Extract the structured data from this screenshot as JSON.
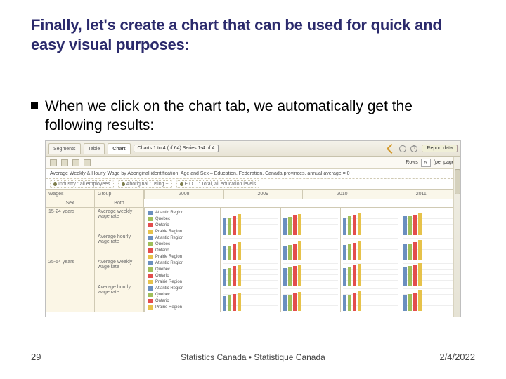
{
  "slide": {
    "title": "Finally, let's create a chart that can be used for quick and easy visual purposes:",
    "bullet": "When we click on the chart tab, we automatically get the following results:",
    "page_number": "29",
    "footer_center": "Statistics Canada • Statistique Canada",
    "footer_date": "2/4/2022"
  },
  "app": {
    "tabs": [
      "Segments",
      "Table",
      "Chart"
    ],
    "active_tab": "Chart",
    "breadcrumb": "Charts 1 to 4 (of 64)   Series 1-4 of 4",
    "report_button": "Report data",
    "rows_label": "Rows",
    "rows_value": "5",
    "rows_per_page": "(per page)",
    "headline": "Average Weekly & Hourly Wage by Aboriginal identification, Age and Sex – Education, Federation, Canada provinces, annual average = 0",
    "criteria": {
      "industry": {
        "label": "Industry",
        "value": "all employees"
      },
      "aboriginal": {
        "label": "Aboriginal",
        "value": "using +"
      },
      "eol": {
        "label": "E.O.L",
        "value": "Total, all education levels"
      }
    },
    "left_header": "Wages",
    "row_labels": {
      "age1": "15-24 years",
      "age2": "25-54 years",
      "sex_hdr": "Sex",
      "both": "Both",
      "wage_type_weekly": "Average weekly wage rate",
      "wage_type_hourly": "Average hourly wage rate",
      "group_label": "Group"
    },
    "legend": [
      "Atlantic Region",
      "Quebec",
      "Ontario",
      "Prairie Region"
    ],
    "colors": {
      "Atlantic Region": "#6a8fbf",
      "Quebec": "#9fbf5a",
      "Ontario": "#e34d4d",
      "Prairie Region": "#e6c24a"
    },
    "years": [
      "2008",
      "2009",
      "2010",
      "2011"
    ]
  },
  "chart_data": [
    {
      "type": "bar",
      "title": "Average weekly wage rate — 15-24 years, Both sexes",
      "xlabel": "",
      "ylabel": "",
      "ylim": [
        0,
        600
      ],
      "categories": [
        "2008",
        "2009",
        "2010",
        "2011"
      ],
      "series": [
        {
          "name": "Atlantic Region",
          "values": [
            390,
            400,
            410,
            430
          ]
        },
        {
          "name": "Quebec",
          "values": [
            400,
            420,
            430,
            440
          ]
        },
        {
          "name": "Ontario",
          "values": [
            440,
            450,
            460,
            470
          ]
        },
        {
          "name": "Prairie Region",
          "values": [
            480,
            490,
            500,
            520
          ]
        }
      ]
    },
    {
      "type": "bar",
      "title": "Average hourly wage rate — 15-24 years, Both sexes",
      "xlabel": "",
      "ylabel": "",
      "ylim": [
        0,
        20
      ],
      "categories": [
        "2008",
        "2009",
        "2010",
        "2011"
      ],
      "series": [
        {
          "name": "Atlantic Region",
          "values": [
            11,
            11.5,
            12,
            12.5
          ]
        },
        {
          "name": "Quebec",
          "values": [
            11.5,
            12,
            12.5,
            13
          ]
        },
        {
          "name": "Ontario",
          "values": [
            12.5,
            13,
            13.5,
            14
          ]
        },
        {
          "name": "Prairie Region",
          "values": [
            14,
            14.5,
            15,
            15.5
          ]
        }
      ]
    },
    {
      "type": "bar",
      "title": "Average weekly wage rate — 25-54 years, Both sexes",
      "xlabel": "",
      "ylabel": "",
      "ylim": [
        0,
        1200
      ],
      "categories": [
        "2008",
        "2009",
        "2010",
        "2011"
      ],
      "series": [
        {
          "name": "Atlantic Region",
          "values": [
            780,
            800,
            820,
            850
          ]
        },
        {
          "name": "Quebec",
          "values": [
            820,
            840,
            870,
            900
          ]
        },
        {
          "name": "Ontario",
          "values": [
            900,
            920,
            950,
            980
          ]
        },
        {
          "name": "Prairie Region",
          "values": [
            950,
            970,
            1000,
            1050
          ]
        }
      ]
    },
    {
      "type": "bar",
      "title": "Average hourly wage rate — 25-54 years, Both sexes",
      "xlabel": "",
      "ylabel": "",
      "ylim": [
        0,
        35
      ],
      "categories": [
        "2008",
        "2009",
        "2010",
        "2011"
      ],
      "series": [
        {
          "name": "Atlantic Region",
          "values": [
            20,
            20.5,
            21,
            22
          ]
        },
        {
          "name": "Quebec",
          "values": [
            21,
            21.5,
            22,
            23
          ]
        },
        {
          "name": "Ontario",
          "values": [
            23,
            23.5,
            24,
            25
          ]
        },
        {
          "name": "Prairie Region",
          "values": [
            25,
            26,
            27,
            28
          ]
        }
      ]
    }
  ]
}
